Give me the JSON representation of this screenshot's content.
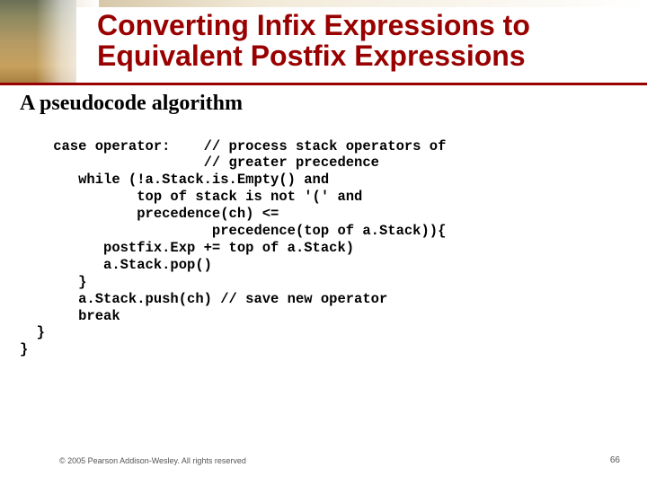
{
  "title": {
    "line1": "Converting Infix Expressions to",
    "line2": "Equivalent Postfix Expressions"
  },
  "subhead": "A pseudocode algorithm",
  "code": "    case operator:    // process stack operators of\n                      // greater precedence\n       while (!a.Stack.is.Empty() and\n              top of stack is not '(' and\n              precedence(ch) <=\n                       precedence(top of a.Stack)){\n          postfix.Exp += top of a.Stack)\n          a.Stack.pop()\n       }\n       a.Stack.push(ch) // save new operator\n       break\n  }\n}",
  "footer": {
    "copyright": "© 2005 Pearson Addison-Wesley. All rights reserved",
    "page": "66"
  }
}
